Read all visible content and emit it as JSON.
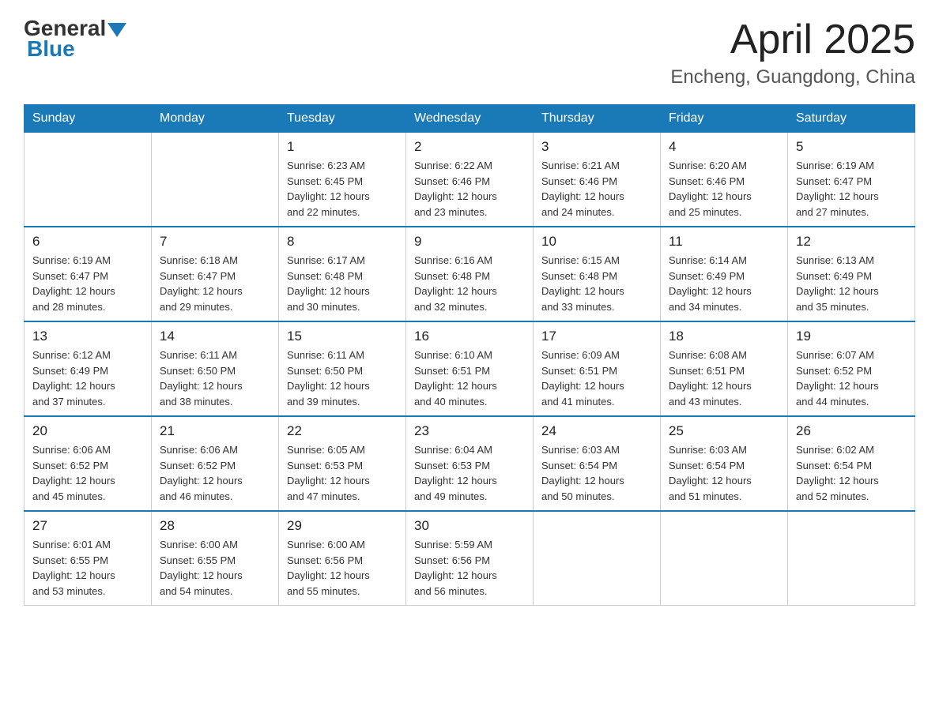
{
  "header": {
    "logo_general": "General",
    "logo_blue": "Blue",
    "month_year": "April 2025",
    "location": "Encheng, Guangdong, China"
  },
  "days_of_week": [
    "Sunday",
    "Monday",
    "Tuesday",
    "Wednesday",
    "Thursday",
    "Friday",
    "Saturday"
  ],
  "weeks": [
    [
      {
        "day": "",
        "info": ""
      },
      {
        "day": "",
        "info": ""
      },
      {
        "day": "1",
        "info": "Sunrise: 6:23 AM\nSunset: 6:45 PM\nDaylight: 12 hours\nand 22 minutes."
      },
      {
        "day": "2",
        "info": "Sunrise: 6:22 AM\nSunset: 6:46 PM\nDaylight: 12 hours\nand 23 minutes."
      },
      {
        "day": "3",
        "info": "Sunrise: 6:21 AM\nSunset: 6:46 PM\nDaylight: 12 hours\nand 24 minutes."
      },
      {
        "day": "4",
        "info": "Sunrise: 6:20 AM\nSunset: 6:46 PM\nDaylight: 12 hours\nand 25 minutes."
      },
      {
        "day": "5",
        "info": "Sunrise: 6:19 AM\nSunset: 6:47 PM\nDaylight: 12 hours\nand 27 minutes."
      }
    ],
    [
      {
        "day": "6",
        "info": "Sunrise: 6:19 AM\nSunset: 6:47 PM\nDaylight: 12 hours\nand 28 minutes."
      },
      {
        "day": "7",
        "info": "Sunrise: 6:18 AM\nSunset: 6:47 PM\nDaylight: 12 hours\nand 29 minutes."
      },
      {
        "day": "8",
        "info": "Sunrise: 6:17 AM\nSunset: 6:48 PM\nDaylight: 12 hours\nand 30 minutes."
      },
      {
        "day": "9",
        "info": "Sunrise: 6:16 AM\nSunset: 6:48 PM\nDaylight: 12 hours\nand 32 minutes."
      },
      {
        "day": "10",
        "info": "Sunrise: 6:15 AM\nSunset: 6:48 PM\nDaylight: 12 hours\nand 33 minutes."
      },
      {
        "day": "11",
        "info": "Sunrise: 6:14 AM\nSunset: 6:49 PM\nDaylight: 12 hours\nand 34 minutes."
      },
      {
        "day": "12",
        "info": "Sunrise: 6:13 AM\nSunset: 6:49 PM\nDaylight: 12 hours\nand 35 minutes."
      }
    ],
    [
      {
        "day": "13",
        "info": "Sunrise: 6:12 AM\nSunset: 6:49 PM\nDaylight: 12 hours\nand 37 minutes."
      },
      {
        "day": "14",
        "info": "Sunrise: 6:11 AM\nSunset: 6:50 PM\nDaylight: 12 hours\nand 38 minutes."
      },
      {
        "day": "15",
        "info": "Sunrise: 6:11 AM\nSunset: 6:50 PM\nDaylight: 12 hours\nand 39 minutes."
      },
      {
        "day": "16",
        "info": "Sunrise: 6:10 AM\nSunset: 6:51 PM\nDaylight: 12 hours\nand 40 minutes."
      },
      {
        "day": "17",
        "info": "Sunrise: 6:09 AM\nSunset: 6:51 PM\nDaylight: 12 hours\nand 41 minutes."
      },
      {
        "day": "18",
        "info": "Sunrise: 6:08 AM\nSunset: 6:51 PM\nDaylight: 12 hours\nand 43 minutes."
      },
      {
        "day": "19",
        "info": "Sunrise: 6:07 AM\nSunset: 6:52 PM\nDaylight: 12 hours\nand 44 minutes."
      }
    ],
    [
      {
        "day": "20",
        "info": "Sunrise: 6:06 AM\nSunset: 6:52 PM\nDaylight: 12 hours\nand 45 minutes."
      },
      {
        "day": "21",
        "info": "Sunrise: 6:06 AM\nSunset: 6:52 PM\nDaylight: 12 hours\nand 46 minutes."
      },
      {
        "day": "22",
        "info": "Sunrise: 6:05 AM\nSunset: 6:53 PM\nDaylight: 12 hours\nand 47 minutes."
      },
      {
        "day": "23",
        "info": "Sunrise: 6:04 AM\nSunset: 6:53 PM\nDaylight: 12 hours\nand 49 minutes."
      },
      {
        "day": "24",
        "info": "Sunrise: 6:03 AM\nSunset: 6:54 PM\nDaylight: 12 hours\nand 50 minutes."
      },
      {
        "day": "25",
        "info": "Sunrise: 6:03 AM\nSunset: 6:54 PM\nDaylight: 12 hours\nand 51 minutes."
      },
      {
        "day": "26",
        "info": "Sunrise: 6:02 AM\nSunset: 6:54 PM\nDaylight: 12 hours\nand 52 minutes."
      }
    ],
    [
      {
        "day": "27",
        "info": "Sunrise: 6:01 AM\nSunset: 6:55 PM\nDaylight: 12 hours\nand 53 minutes."
      },
      {
        "day": "28",
        "info": "Sunrise: 6:00 AM\nSunset: 6:55 PM\nDaylight: 12 hours\nand 54 minutes."
      },
      {
        "day": "29",
        "info": "Sunrise: 6:00 AM\nSunset: 6:56 PM\nDaylight: 12 hours\nand 55 minutes."
      },
      {
        "day": "30",
        "info": "Sunrise: 5:59 AM\nSunset: 6:56 PM\nDaylight: 12 hours\nand 56 minutes."
      },
      {
        "day": "",
        "info": ""
      },
      {
        "day": "",
        "info": ""
      },
      {
        "day": "",
        "info": ""
      }
    ]
  ]
}
